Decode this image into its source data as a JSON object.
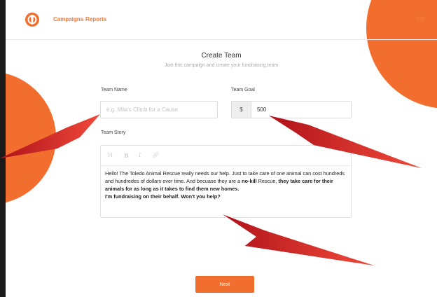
{
  "nav": {
    "campaigns": "Campaigns",
    "reports": "Reports",
    "user_initials": "FM"
  },
  "form": {
    "title": "Create Team",
    "subtitle": "Join this campaign and create your fundraising team",
    "team_name_label": "Team Name",
    "team_name_placeholder": "e.g. Mila's Climb for a Cause",
    "team_goal_label": "Team Goal",
    "goal_currency": "$",
    "goal_value": "500",
    "team_story_label": "Team Story"
  },
  "editor": {
    "toolbar": {
      "heading": "H",
      "bold": "B",
      "italic": "I",
      "link_icon": "link-icon"
    },
    "story": {
      "p1": "Hello! The Toledo Animal Rescue really needs our help. Just to take care of one animal can cost hundreds and hundredes of dollars over time.  And becuase they are a ",
      "p1_bold": "no-kill",
      "p1_end": " Rescue, ",
      "p2_bold": "they take care for their animals for as long as it takes to find them new homes.",
      "p3_bold": "I'm fundraising on their behalf. Won't you help?"
    }
  },
  "actions": {
    "next": "Next"
  },
  "colors": {
    "brand": "#f26e2e",
    "arrow": "#e8352b",
    "background": "#ffffff"
  }
}
